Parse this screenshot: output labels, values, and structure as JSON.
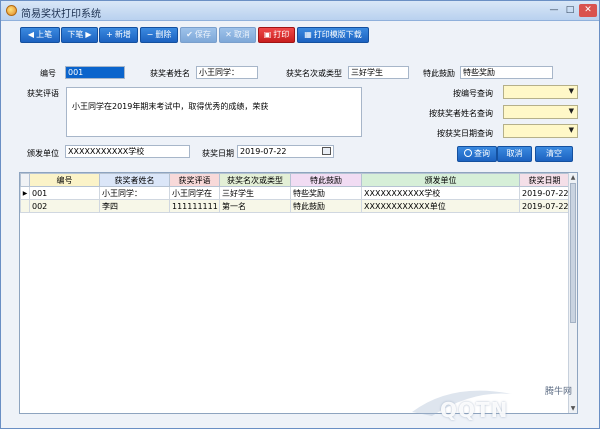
{
  "window": {
    "title": "简易奖状打印系统",
    "min": "—",
    "max": "□",
    "close": "✕"
  },
  "toolbar": [
    {
      "icon": "◀",
      "label": "上笔"
    },
    {
      "icon": "▶",
      "label": "下笔"
    },
    {
      "icon": "+",
      "label": "新增"
    },
    {
      "icon": "−",
      "label": "删除"
    },
    {
      "icon": "✔",
      "label": "保存"
    },
    {
      "icon": "✕",
      "label": "取消"
    },
    {
      "icon": "▣",
      "label": "打印"
    },
    {
      "icon": "▦",
      "label": "打印模版下载"
    }
  ],
  "form": {
    "id_label": "编号",
    "id_value": "001",
    "name_label": "获奖者姓名",
    "name_value": "小王同学：",
    "rank_label": "获奖名次或类型",
    "rank_value": "三好学生",
    "reward_label": "特此鼓励",
    "reward_value": "特些奖励",
    "comment_label": "获奖评语",
    "comment_value": "小王同学在2019年期末考试中，取得优秀的成绩，荣获",
    "issuer_label": "颁发单位",
    "issuer_value": "XXXXXXXXXXX学校",
    "date_label": "获奖日期",
    "date_value": "2019-07-22"
  },
  "search": {
    "by_id_label": "按编号查询",
    "by_name_label": "按获奖者姓名查询",
    "by_date_label": "按获奖日期查询",
    "query_label": "查询",
    "cancel_label": "取消",
    "clear_label": "清空",
    "query_icon": "search-icon"
  },
  "grid": {
    "columns": [
      "编号",
      "获奖者姓名",
      "获奖评语",
      "获奖名次或类型",
      "特此鼓励",
      "颁发单位",
      "获奖日期"
    ],
    "column_colors": [
      "#fbf3c8",
      "#dbe6f8",
      "#f8d9d9",
      "#e3efd6",
      "#f1dcf3",
      "#d6efd8",
      "#f4dfe8"
    ],
    "rows": [
      [
        "001",
        "小王同学：",
        "小王同学在",
        "三好学生",
        "特些奖励",
        "XXXXXXXXXXX学校",
        "2019-07-22"
      ],
      [
        "002",
        "李四",
        "111111111",
        "第一名",
        "特此鼓励",
        "XXXXXXXXXXXX单位",
        "2019-07-22"
      ]
    ]
  },
  "watermark": {
    "brand": "QQTN",
    "cn": "腾牛网"
  }
}
